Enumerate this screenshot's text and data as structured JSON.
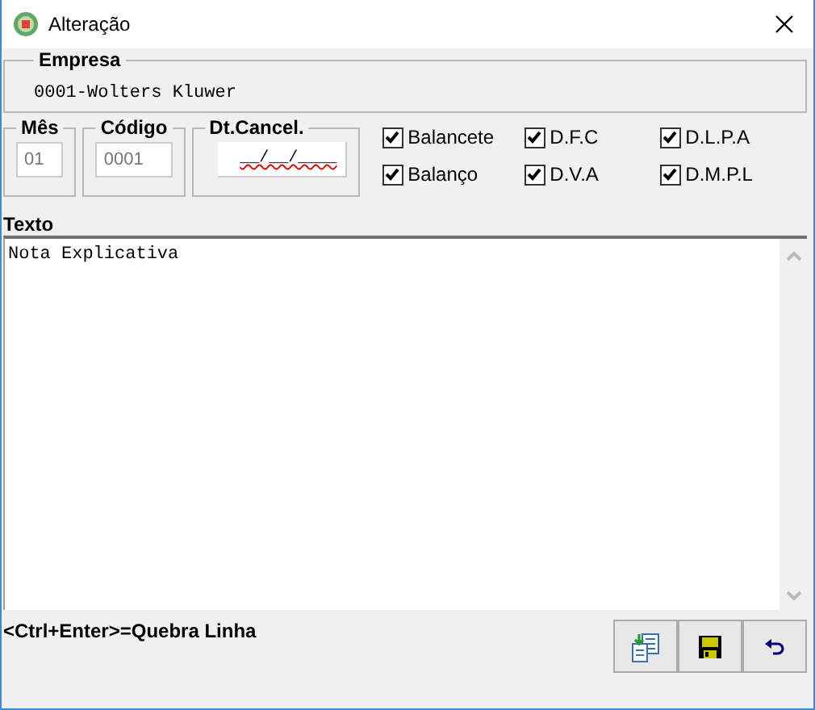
{
  "window": {
    "title": "Alteração"
  },
  "empresa": {
    "legend": "Empresa",
    "value": "0001-Wolters Kluwer"
  },
  "fields": [
    {
      "legend": "Mês",
      "value": "01",
      "disabled": true
    },
    {
      "legend": "Código",
      "value": "0001",
      "disabled": true
    },
    {
      "legend": "Dt.Cancel.",
      "value": "__/__/____"
    }
  ],
  "checkboxes": [
    {
      "label": "Balancete",
      "checked": true
    },
    {
      "label": "D.F.C",
      "checked": true
    },
    {
      "label": "D.L.P.A",
      "checked": true
    },
    {
      "label": "Balanço",
      "checked": true
    },
    {
      "label": "D.V.A",
      "checked": true
    },
    {
      "label": "D.M.P.L",
      "checked": true
    }
  ],
  "texto": {
    "label": "Texto",
    "value": "Nota Explicativa"
  },
  "hint": "<Ctrl+Enter>=Quebra Linha"
}
